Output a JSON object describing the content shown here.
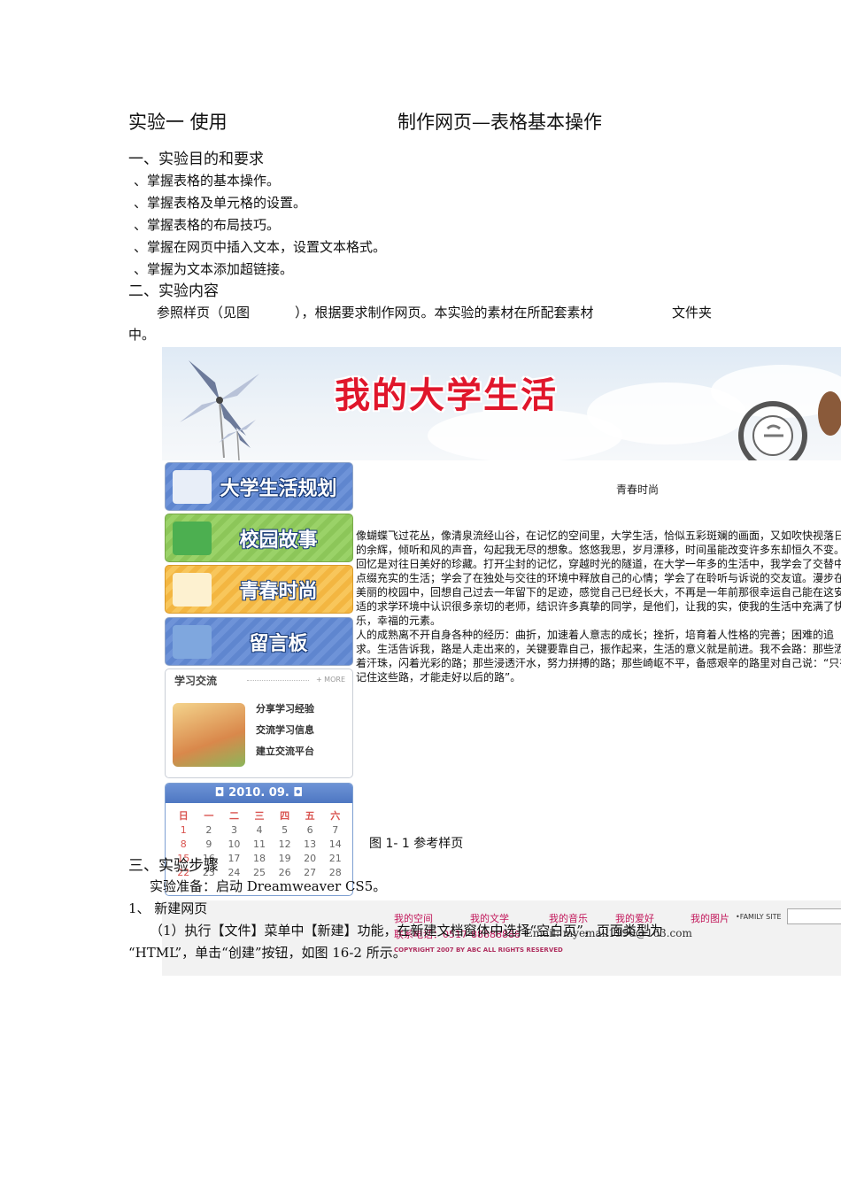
{
  "title": {
    "left": "实验一  使用",
    "right": "制作网页—表格基本操作"
  },
  "section1": {
    "heading": "一、实验目的和要求",
    "items": [
      "、掌握表格的基本操作。",
      "、掌握表格及单元格的设置。",
      "、掌握表格的布局技巧。",
      "、掌握在网页中插入文本，设置文本格式。",
      "、掌握为文本添加超链接。"
    ]
  },
  "section2": {
    "heading": "二、实验内容",
    "line1_a": "参照样页（见图",
    "line1_b": "），根据要求制作网页。本实验的素材在所配套素材",
    "line1_c": "文件夹",
    "line2": "中。"
  },
  "sample": {
    "banner_title": "我的大学生活",
    "nav": [
      "大学生活规划",
      "校园故事",
      "青春时尚",
      "留言板"
    ],
    "exchange": {
      "heading": "学习交流",
      "more": "+ MORE",
      "links": [
        "分享学习经验",
        "交流学习信息",
        "建立交流平台"
      ]
    },
    "calendar": {
      "header": "◘ 2010. 09. ◘",
      "weekdays": [
        "日",
        "一",
        "二",
        "三",
        "四",
        "五",
        "六"
      ],
      "weeks": [
        [
          "1",
          "2",
          "3",
          "4",
          "5",
          "6",
          "7"
        ],
        [
          "8",
          "9",
          "10",
          "11",
          "12",
          "13",
          "14"
        ],
        [
          "15",
          "16",
          "17",
          "18",
          "19",
          "20",
          "21"
        ],
        [
          "22",
          "23",
          "24",
          "25",
          "26",
          "27",
          "28"
        ]
      ]
    },
    "content_title": "青春时尚",
    "paragraphs": [
      "像蝴蝶飞过花丛，像清泉流经山谷，在记忆的空间里，大学生活，恰似五彩斑斓的画面，又如吹快视落日的余辉，倾听和风的声音，勾起我无尽的想象。悠悠我思，岁月漂移，时间虽能改变许多东却恒久不变。",
      "回忆是对往日美好的珍藏。打开尘封的记忆，穿越时光的隧道，在大学一年多的生活中，我学会了交替中点缀充实的生活；学会了在独处与交往的环境中释放自己的心情；学会了在聆听与诉说的交友谊。漫步在美丽的校园中，回想自己过去一年留下的足迹，感觉自己已经长大，不再是一年前那很幸运自己能在这安适的求学环境中认识很多亲切的老师，结识许多真挚的同学，是他们，让我的实，使我的生活中充满了快乐，幸福的元素。",
      "人的成熟离不开自身各种的经历：曲折，加速着人意志的成长；挫折，培育着人性格的完善；困难的追求。生活告诉我，路是人走出来的，关键要靠自己，振作起来，生活的意义就是前进。我不会路：那些洒着汗珠，闪着光彩的路；那些浸透汗水，努力拼搏的路；那些崎岖不平，备感艰辛的路里对自己说：“只有记住这些路，才能走好以后的路”。"
    ],
    "footer": {
      "links": [
        "我的空间",
        "我的文学",
        "我的音乐",
        "我的爱好",
        "我的图片"
      ],
      "family": "•FAMILY SITE",
      "phone": "联系电话：0517-88888888",
      "email": "Email:   myemail1990@163.com",
      "copyright": "COPYRIGHT 2007 BY ABC ALL RIGHTS RESERVED"
    }
  },
  "caption": "图 1- 1  参考样页",
  "section3": {
    "heading": "三、实验步骤",
    "prep": "实验准备：启动 Dreamweaver CS5。",
    "step1": "1、 新建网页",
    "step1_text_a": "（1）执行【文件】菜单中【新建】功能，在新建文档窗体中选择“空白页”，页面类型为",
    "step1_text_b": "“HTML”，单击“创建”按钮，如图 16-2 所示。"
  }
}
